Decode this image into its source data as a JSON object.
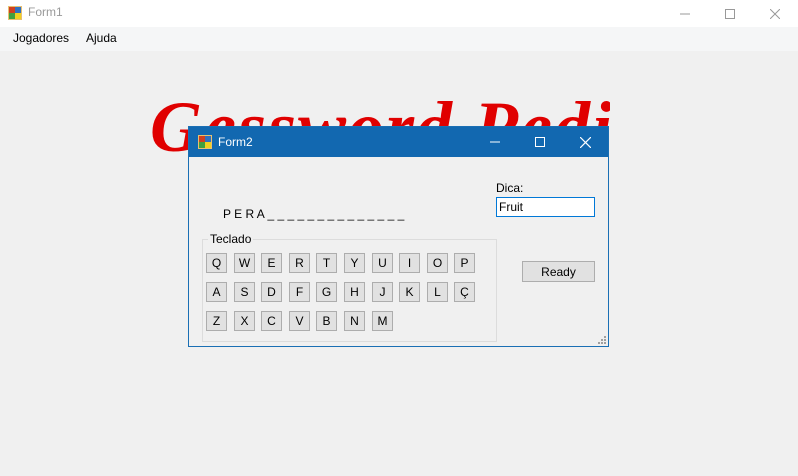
{
  "form1": {
    "title": "Form1",
    "menu": [
      "Jogadores",
      "Ajuda"
    ],
    "minimize_icon": "minimize-icon",
    "maximize_icon": "maximize-icon",
    "close_icon": "close-icon"
  },
  "logo": {
    "text": "Gessword Pedido",
    "color": "#e00000"
  },
  "form2": {
    "title": "Form2",
    "word": "P E R A _ _ _ _ _ _ _ _ _ _ _ _ _ _",
    "hint_label": "Dica:",
    "hint_value": "Fruit",
    "ready_label": "Ready",
    "keyboard_label": "Teclado",
    "keyboard_rows": [
      [
        "Q",
        "W",
        "E",
        "R",
        "T",
        "Y",
        "U",
        "I",
        "O",
        "P"
      ],
      [
        "A",
        "S",
        "D",
        "F",
        "G",
        "H",
        "J",
        "K",
        "L",
        "Ç"
      ],
      [
        "Z",
        "X",
        "C",
        "V",
        "B",
        "N",
        "M"
      ]
    ],
    "title_bar_color": "#1268b0"
  }
}
